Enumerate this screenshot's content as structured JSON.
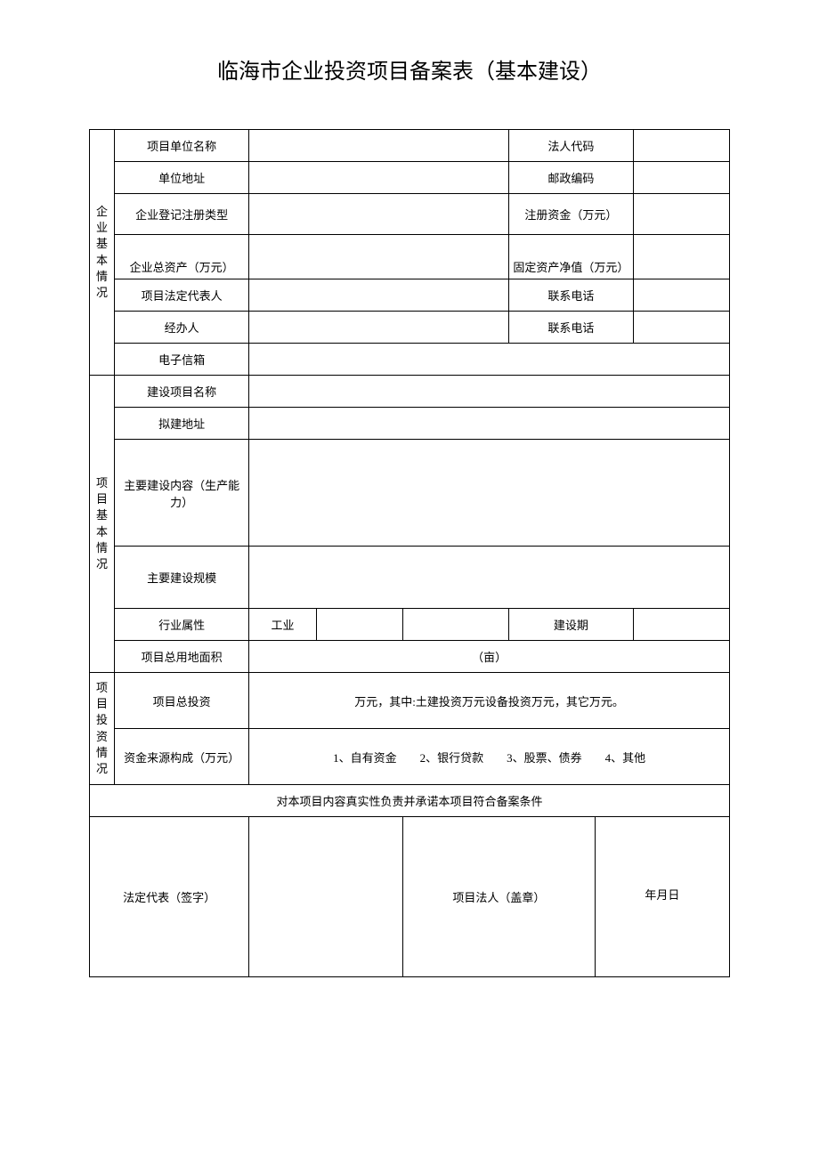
{
  "title": "临海市企业投资项目备案表（基本建设）",
  "section1": {
    "header": "企业基本情况",
    "r1a": "项目单位名称",
    "r1b": "法人代码",
    "r2a": "单位地址",
    "r2b": "邮政编码",
    "r3a": "企业登记注册类型",
    "r3b": "注册资金（万元）",
    "r4a": "企业总资产（万元）",
    "r4b": "固定资产净值（万元）",
    "r5a": "项目法定代表人",
    "r5b": "联系电话",
    "r6a": "经办人",
    "r6b": "联系电话",
    "r7a": "电子信箱"
  },
  "section2": {
    "header": "项目基本情况",
    "r1a": "建设项目名称",
    "r2a": "拟建地址",
    "r3a": "主要建设内容（生产能力）",
    "r4a": "主要建设规模",
    "r5a": "行业属性",
    "r5b": "工业",
    "r5c": "建设期",
    "r6a": "项目总用地面积",
    "r6b": "（亩）"
  },
  "section3": {
    "header": "项目投资情况",
    "r1a": "项目总投资",
    "r1b": "万元，其中:土建投资万元设备投资万元，其它万元。",
    "r2a": "资金来源构成（万元）",
    "r2b": "1、自有资金　　2、银行贷款　　3、股票、债券　　4、其他"
  },
  "commitment": "对本项目内容真实性负责并承诺本项目符合备案条件",
  "sig": {
    "left": "法定代表（签字）",
    "right": "项目法人（盖章）",
    "date": "年月日"
  }
}
